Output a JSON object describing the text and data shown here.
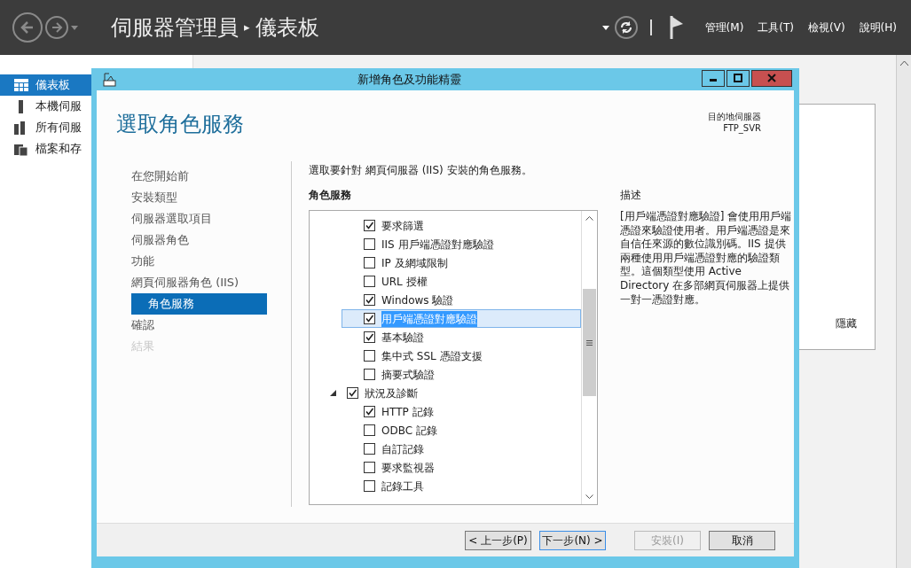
{
  "app": {
    "title": "伺服器管理員",
    "separator": "▸",
    "page": "儀表板",
    "menus": [
      "管理(M)",
      "工具(T)",
      "檢視(V)",
      "說明(H)"
    ]
  },
  "nav": [
    {
      "label": "儀表板",
      "selected": true
    },
    {
      "label": "本機伺服",
      "selected": false
    },
    {
      "label": "所有伺服",
      "selected": false
    },
    {
      "label": "檔案和存",
      "selected": false
    }
  ],
  "background_panel": {
    "link": "隱藏"
  },
  "wizard": {
    "title": "新增角色及功能精靈",
    "heading": "選取角色服務",
    "destination_label": "目的地伺服器",
    "destination": "FTP_SVR",
    "steps": [
      {
        "label": "在您開始前",
        "kind": "step",
        "selected": false,
        "disabled": false
      },
      {
        "label": "安裝類型",
        "kind": "step",
        "selected": false,
        "disabled": false
      },
      {
        "label": "伺服器選取項目",
        "kind": "step",
        "selected": false,
        "disabled": false
      },
      {
        "label": "伺服器角色",
        "kind": "step",
        "selected": false,
        "disabled": false
      },
      {
        "label": "功能",
        "kind": "step",
        "selected": false,
        "disabled": false
      },
      {
        "label": "網頁伺服器角色 (IIS)",
        "kind": "step",
        "selected": false,
        "disabled": false
      },
      {
        "label": "角色服務",
        "kind": "sub",
        "selected": true,
        "disabled": false
      },
      {
        "label": "確認",
        "kind": "step",
        "selected": false,
        "disabled": false
      },
      {
        "label": "結果",
        "kind": "step",
        "selected": false,
        "disabled": true
      }
    ],
    "instruction": "選取要針對 網頁伺服器 (IIS) 安裝的角色服務。",
    "list_heading": "角色服務",
    "tree": [
      {
        "children": [
          {
            "label": "要求篩選",
            "checked": true,
            "selected": false
          },
          {
            "label": "IIS 用戶端憑證對應驗證",
            "checked": false,
            "selected": false
          },
          {
            "label": "IP 及網域限制",
            "checked": false,
            "selected": false
          },
          {
            "label": "URL 授權",
            "checked": false,
            "selected": false
          },
          {
            "label": "Windows 驗證",
            "checked": true,
            "selected": false
          },
          {
            "label": "用戶端憑證對應驗證",
            "checked": true,
            "selected": true
          },
          {
            "label": "基本驗證",
            "checked": true,
            "selected": false
          },
          {
            "label": "集中式 SSL 憑證支援",
            "checked": false,
            "selected": false
          },
          {
            "label": "摘要式驗證",
            "checked": false,
            "selected": false
          }
        ]
      },
      {
        "label": "狀況及診斷",
        "checked": true,
        "selected": false,
        "expanded": true,
        "children": [
          {
            "label": "HTTP 記錄",
            "checked": true,
            "selected": false
          },
          {
            "label": "ODBC 記錄",
            "checked": false,
            "selected": false
          },
          {
            "label": "自訂記錄",
            "checked": false,
            "selected": false
          },
          {
            "label": "要求監視器",
            "checked": false,
            "selected": false
          },
          {
            "label": "記錄工具",
            "checked": false,
            "selected": false
          }
        ]
      }
    ],
    "description_heading": "描述",
    "description": "[用戶端憑證對應驗證] 會使用用戶端憑證來驗證使用者。用戶端憑證是來自信任來源的數位識別碼。IIS 提供兩種使用用戶端憑證對應的驗證類型。這個類型使用 Active Directory 在多部網頁伺服器上提供一對一憑證對應。",
    "buttons": [
      {
        "label": "< 上一步(P)",
        "kind": "normal",
        "disabled": false
      },
      {
        "label": "下一步(N) >",
        "kind": "default",
        "disabled": false
      },
      {
        "label": "安裝(I)",
        "kind": "normal",
        "disabled": true
      },
      {
        "label": "取消",
        "kind": "normal",
        "disabled": false
      }
    ]
  }
}
